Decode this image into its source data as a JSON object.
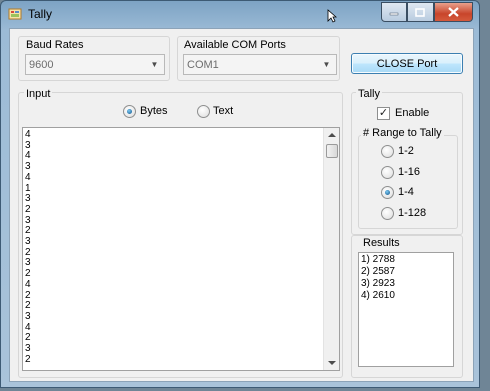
{
  "window": {
    "title": "Tally"
  },
  "baud": {
    "group_label": "Baud Rates",
    "selected": "9600"
  },
  "com": {
    "group_label": "Available COM Ports",
    "selected": "COM1"
  },
  "close_port_label": "CLOSE Port",
  "input": {
    "group_label": "Input",
    "radio_bytes": "Bytes",
    "radio_text": "Text",
    "selected_mode": "Bytes",
    "lines": [
      "4",
      "3",
      "4",
      "3",
      "4",
      "1",
      "3",
      "2",
      "3",
      "2",
      "3",
      "2",
      "3",
      "2",
      "4",
      "2",
      "2",
      "3",
      "4",
      "2",
      "3",
      "2"
    ]
  },
  "tally": {
    "group_label": "Tally",
    "enable_label": "Enable",
    "enable_checked": true,
    "range_label": "# Range to Tally",
    "ranges": [
      "1-2",
      "1-16",
      "1-4",
      "1-128"
    ],
    "selected_range": "1-4"
  },
  "results": {
    "group_label": "Results",
    "items": [
      "1) 2788",
      "2) 2587",
      "3) 2923",
      "4) 2610"
    ]
  },
  "icons": {
    "app": "tally-app-icon",
    "minimize": "minimize-icon",
    "maximize": "maximize-icon",
    "close": "close-icon",
    "dropdown": "chevron-down-icon",
    "scroll_up": "scroll-up-icon",
    "scroll_down": "scroll-down-icon",
    "cursor": "mouse-cursor-icon"
  },
  "colors": {
    "desktop": "#6f8596",
    "title_bar": "#9cbbd6",
    "close_button": "#c8452b",
    "radio_dot": "#0a4e86",
    "button_border": "#3c7fb1"
  }
}
